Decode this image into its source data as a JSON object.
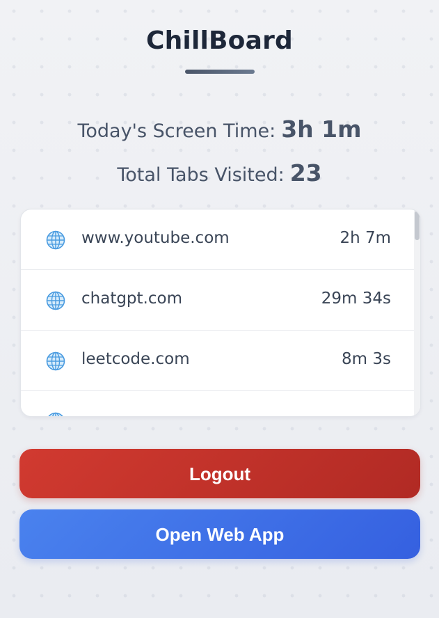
{
  "app": {
    "title": "ChillBoard"
  },
  "stats": {
    "screen_time_label": "Today's Screen Time:",
    "screen_time_value": "3h 1m",
    "tabs_label": "Total Tabs Visited:",
    "tabs_value": "23"
  },
  "sites": [
    {
      "domain": "www.youtube.com",
      "duration": "2h 7m",
      "icon": "globe-icon"
    },
    {
      "domain": "chatgpt.com",
      "duration": "29m 34s",
      "icon": "globe-icon"
    },
    {
      "domain": "leetcode.com",
      "duration": "8m 3s",
      "icon": "globe-icon"
    }
  ],
  "buttons": {
    "logout_label": "Logout",
    "open_web_app_label": "Open Web App"
  },
  "colors": {
    "logout": "#c4332b",
    "open_web_app": "#3f6fe6",
    "title": "#1d2739"
  }
}
